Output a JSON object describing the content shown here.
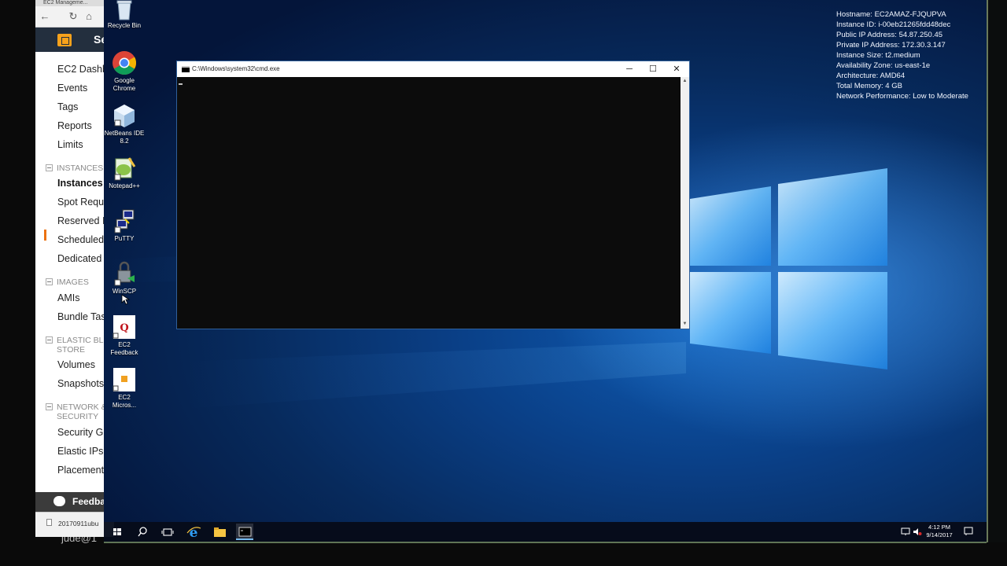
{
  "browser": {
    "tab_title": "EC2 Manageme...",
    "services_label": "Se",
    "nav_items": {
      "dashboard": "EC2 Dashb",
      "events": "Events",
      "tags": "Tags",
      "reports": "Reports",
      "limits": "Limits",
      "instances": "Instances",
      "spot": "Spot Reque",
      "reserved": "Reserved I",
      "scheduled": "Scheduled",
      "dedicated": "Dedicated H",
      "amis": "AMIs",
      "bundle": "Bundle Tas",
      "volumes": "Volumes",
      "snapshots": "Snapshots",
      "security_groups": "Security Gr",
      "elastic_ips": "Elastic IPs",
      "placement": "Placement"
    },
    "sections": {
      "instances": "INSTANCES",
      "images": "IMAGES",
      "ebs_line1": "ELASTIC BL",
      "ebs_line2": "STORE",
      "network_line1": "NETWORK &",
      "network_line2": "SECURITY"
    },
    "feedback_label": "Feedba",
    "download_file": "20170911ubu"
  },
  "desktop_icons": {
    "recycle_bin": "Recycle Bin",
    "chrome_1": "Google",
    "chrome_2": "Chrome",
    "netbeans_1": "NetBeans IDE",
    "netbeans_2": "8.2",
    "notepadpp": "Notepad++",
    "putty": "PuTTY",
    "winscp": "WinSCP",
    "ec2feedback_1": "EC2",
    "ec2feedback_2": "Feedback",
    "ec2micros_1": "EC2",
    "ec2micros_2": "Micros..."
  },
  "sysinfo": {
    "hostname": "Hostname: EC2AMAZ-FJQUPVA",
    "instance_id": "Instance ID: i-00eb21265fdd48dec",
    "public_ip": "Public IP Address: 54.87.250.45",
    "private_ip": "Private IP Address: 172.30.3.147",
    "instance_size": "Instance Size: t2.medium",
    "availability_zone": "Availability Zone: us-east-1e",
    "architecture": "Architecture: AMD64",
    "total_memory": "Total Memory: 4 GB",
    "network_performance": "Network Performance: Low to Moderate"
  },
  "cmd_window": {
    "title": "C:\\Windows\\system32\\cmd.exe",
    "minimize": "─",
    "maximize": "☐",
    "close": "✕"
  },
  "taskbar": {
    "time": "4:12 PM",
    "date": "9/14/2017"
  },
  "behind_text": "jude@1",
  "colors": {
    "aws_header": "#232f3e",
    "aws_accent": "#ec7211",
    "cmd_background": "#0c0c0c",
    "desktop_blue": "#0a3f86",
    "taskbar": "#060c1c"
  }
}
